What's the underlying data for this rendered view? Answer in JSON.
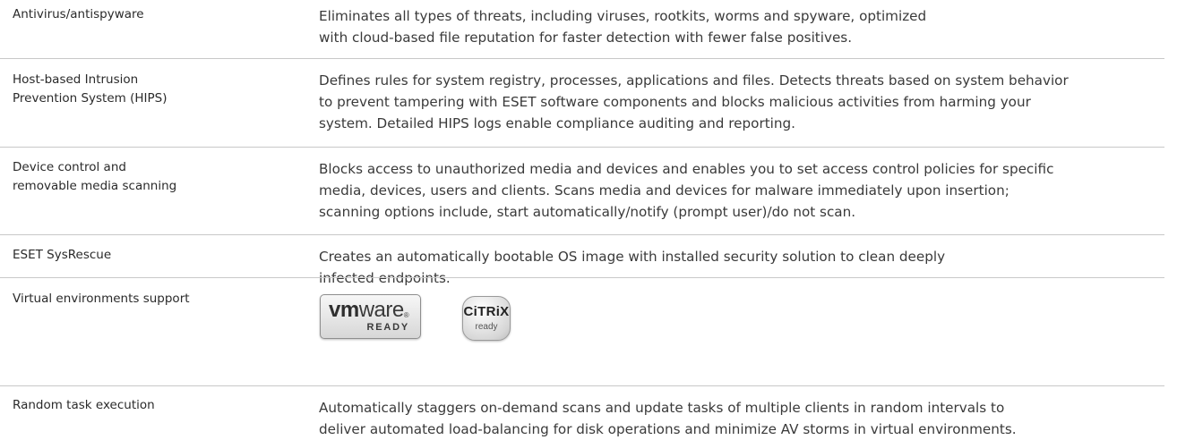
{
  "features": [
    {
      "label": "Antivirus/antispyware",
      "description": "Eliminates all types of threats, including viruses, rootkits, worms and spyware, optimized\nwith cloud-based file reputation for faster detection with fewer false positives."
    },
    {
      "label": "Host-based Intrusion\nPrevention System (HIPS)",
      "description": "Defines rules for system registry, processes, applications and files. Detects threats based on system behavior\nto prevent tampering with ESET software components and blocks malicious activities from harming your\nsystem. Detailed HIPS logs enable compliance auditing and reporting."
    },
    {
      "label": "Device control and\nremovable media scanning",
      "description": "Blocks access to unauthorized media and devices and enables you to set access control policies for specific\nmedia, devices, users and clients. Scans media and devices for malware immediately upon insertion;\nscanning options include, start automatically/notify (prompt user)/do not scan."
    },
    {
      "label": "ESET SysRescue",
      "description": "Creates an automatically bootable OS image with installed security solution to clean deeply\ninfected endpoints."
    },
    {
      "label": "Virtual environments support",
      "description": ""
    },
    {
      "label": "Random task execution",
      "description": "Automatically staggers on-demand scans and update tasks of multiple clients in random intervals to\ndeliver automated load-balancing for disk operations and minimize AV storms in virtual environments."
    }
  ],
  "logos": {
    "vmware": {
      "word_bold": "vm",
      "word_rest": "ware",
      "mark": "®",
      "caption": "READY"
    },
    "citrix": {
      "word": "CiTRiX",
      "caption": "ready"
    }
  }
}
